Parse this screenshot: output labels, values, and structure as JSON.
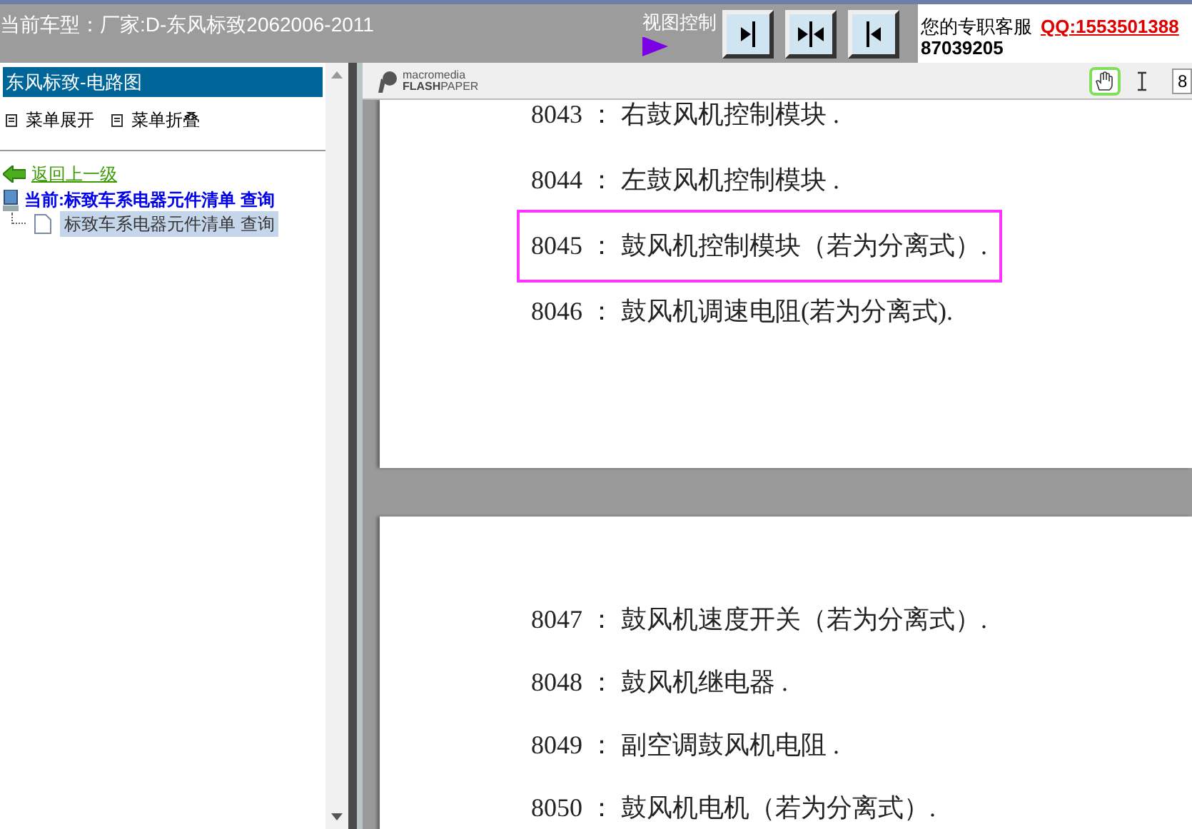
{
  "top_bar": {
    "model": "当前车型：厂家:D-东风标致2062006-2011",
    "view_control": "视图控制",
    "view_buttons": [
      {
        "kind": "right"
      },
      {
        "kind": "both"
      },
      {
        "kind": "left"
      }
    ],
    "support_label": "您的专职客服",
    "support_qq": "QQ:1553501388",
    "support_number": "87039205"
  },
  "sidebar": {
    "title": "东风标致-电路图",
    "menu_actions": [
      "菜单展开",
      "菜单折叠"
    ],
    "back_link": "返回上一级",
    "current": "当前:标致车系电器元件清单 查询",
    "tree": [
      {
        "label": "标致车系电器元件清单 查询",
        "selected": true
      }
    ]
  },
  "viewer": {
    "logo_top": "macromedia",
    "logo_flash": "FLASH",
    "logo_paper": "PAPER",
    "tools": [
      {
        "kind": "hand",
        "selected": true
      },
      {
        "kind": "text",
        "selected": false
      }
    ],
    "page_field": "8",
    "pages": [
      {
        "entries": [
          {
            "text": "8043 ： 右鼓风机控制模块 .",
            "highlighted": false
          },
          {
            "text": "8044 ： 左鼓风机控制模块 .",
            "highlighted": false
          },
          {
            "text": "8045 ： 鼓风机控制模块（若为分离式）.",
            "highlighted": true
          },
          {
            "text": "8046 ： 鼓风机调速电阻(若为分离式).",
            "highlighted": false
          }
        ]
      },
      {
        "entries": [
          {
            "text": "8047 ： 鼓风机速度开关（若为分离式）.",
            "highlighted": false
          },
          {
            "text": "8048 ： 鼓风机继电器 .",
            "highlighted": false
          },
          {
            "text": "8049 ： 副空调鼓风机电阻 .",
            "highlighted": false
          },
          {
            "text": "8050 ： 鼓风机电机（若为分离式）.",
            "highlighted": false
          }
        ]
      }
    ]
  }
}
